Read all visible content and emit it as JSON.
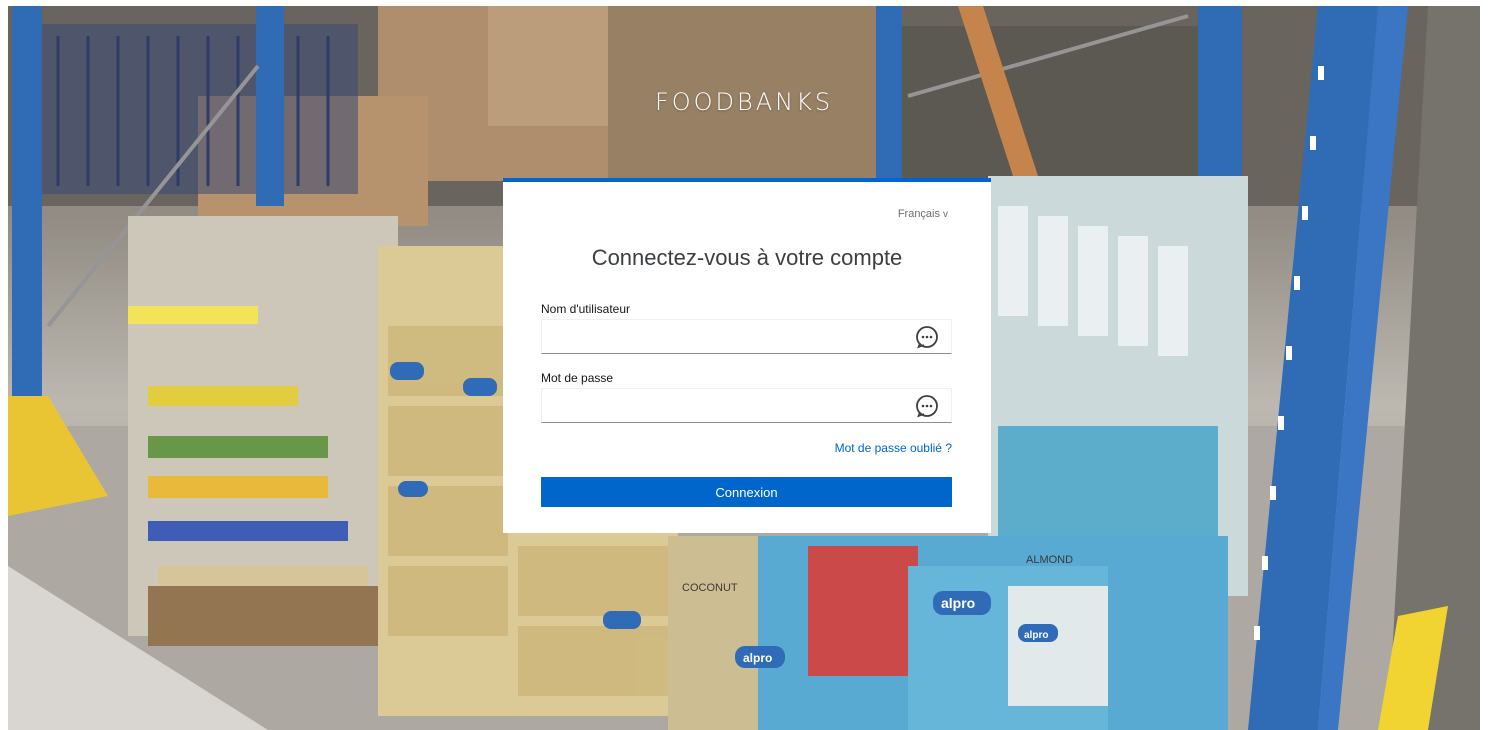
{
  "brand": {
    "title": "FOODBANKS"
  },
  "login": {
    "language_label": "Français",
    "language_caret": "v",
    "title": "Connectez-vous à votre compte",
    "username": {
      "label": "Nom d'utilisateur",
      "value": "",
      "placeholder": ""
    },
    "password": {
      "label": "Mot de passe",
      "value": "",
      "placeholder": ""
    },
    "forgot_password": "Mot de passe oublié ?",
    "submit_label": "Connexion",
    "field_icon": "chat-bubble-icon"
  },
  "background_labels": [
    "alpro",
    "alpro",
    "alpro",
    "ALMOND",
    "COCONUT"
  ],
  "colors": {
    "accent": "#0066cc",
    "rack_blue": "#1f5fb0",
    "card_bg": "#ffffff"
  }
}
